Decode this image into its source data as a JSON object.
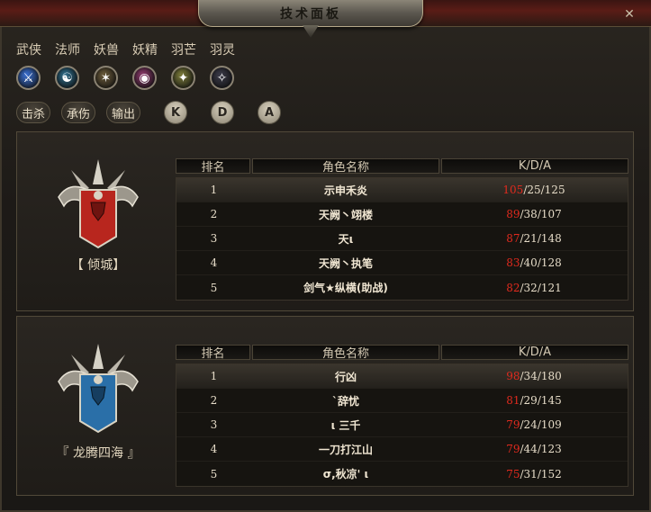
{
  "window": {
    "title": "技术面板",
    "close_label": "✕"
  },
  "classes": [
    {
      "label": "武侠",
      "icon": "sword-icon",
      "color": "#3a6fd1",
      "glyph": "⚔"
    },
    {
      "label": "法师",
      "icon": "taiji-icon",
      "color": "#2d6b88",
      "glyph": "☯"
    },
    {
      "label": "妖兽",
      "icon": "beast-claw-icon",
      "color": "#6a5a3a",
      "glyph": "✶"
    },
    {
      "label": "妖精",
      "icon": "spirit-orb-icon",
      "color": "#8a3a6a",
      "glyph": "◉"
    },
    {
      "label": "羽芒",
      "icon": "feather-blade-icon",
      "color": "#7a7a3a",
      "glyph": "✦"
    },
    {
      "label": "羽灵",
      "icon": "feather-wing-icon",
      "color": "#3a3a48",
      "glyph": "✧"
    }
  ],
  "stat_buttons": [
    "击杀",
    "承伤",
    "输出"
  ],
  "sort_buttons": [
    "K",
    "D",
    "A"
  ],
  "table_headers": {
    "rank": "排名",
    "name": "角色名称",
    "kda": "K/D/A"
  },
  "teams": [
    {
      "name": "【 倾城】",
      "emblem_color": "#b8261e",
      "rows": [
        {
          "rank": "1",
          "name": "示申禾炎",
          "k": "105",
          "rest": "/25/125"
        },
        {
          "rank": "2",
          "name": "天阙丶翊楼",
          "k": "89",
          "rest": "/38/107"
        },
        {
          "rank": "3",
          "name": "天ι",
          "k": "87",
          "rest": "/21/148"
        },
        {
          "rank": "4",
          "name": "天阙丶执笔",
          "k": "83",
          "rest": "/40/128"
        },
        {
          "rank": "5",
          "name": "剑气★纵横(助战)",
          "k": "82",
          "rest": "/32/121"
        }
      ]
    },
    {
      "name": "『 龙腾四海 』",
      "emblem_color": "#2a6fa8",
      "rows": [
        {
          "rank": "1",
          "name": "行凶",
          "k": "98",
          "rest": "/34/180"
        },
        {
          "rank": "2",
          "name": "`辞忧",
          "k": "81",
          "rest": "/29/145"
        },
        {
          "rank": "3",
          "name": "ι 三千",
          "k": "79",
          "rest": "/24/109"
        },
        {
          "rank": "4",
          "name": "一刀打江山",
          "k": "79",
          "rest": "/44/123"
        },
        {
          "rank": "5",
          "name": "σ,秋凉' ι",
          "k": "75",
          "rest": "/31/152"
        }
      ]
    }
  ]
}
